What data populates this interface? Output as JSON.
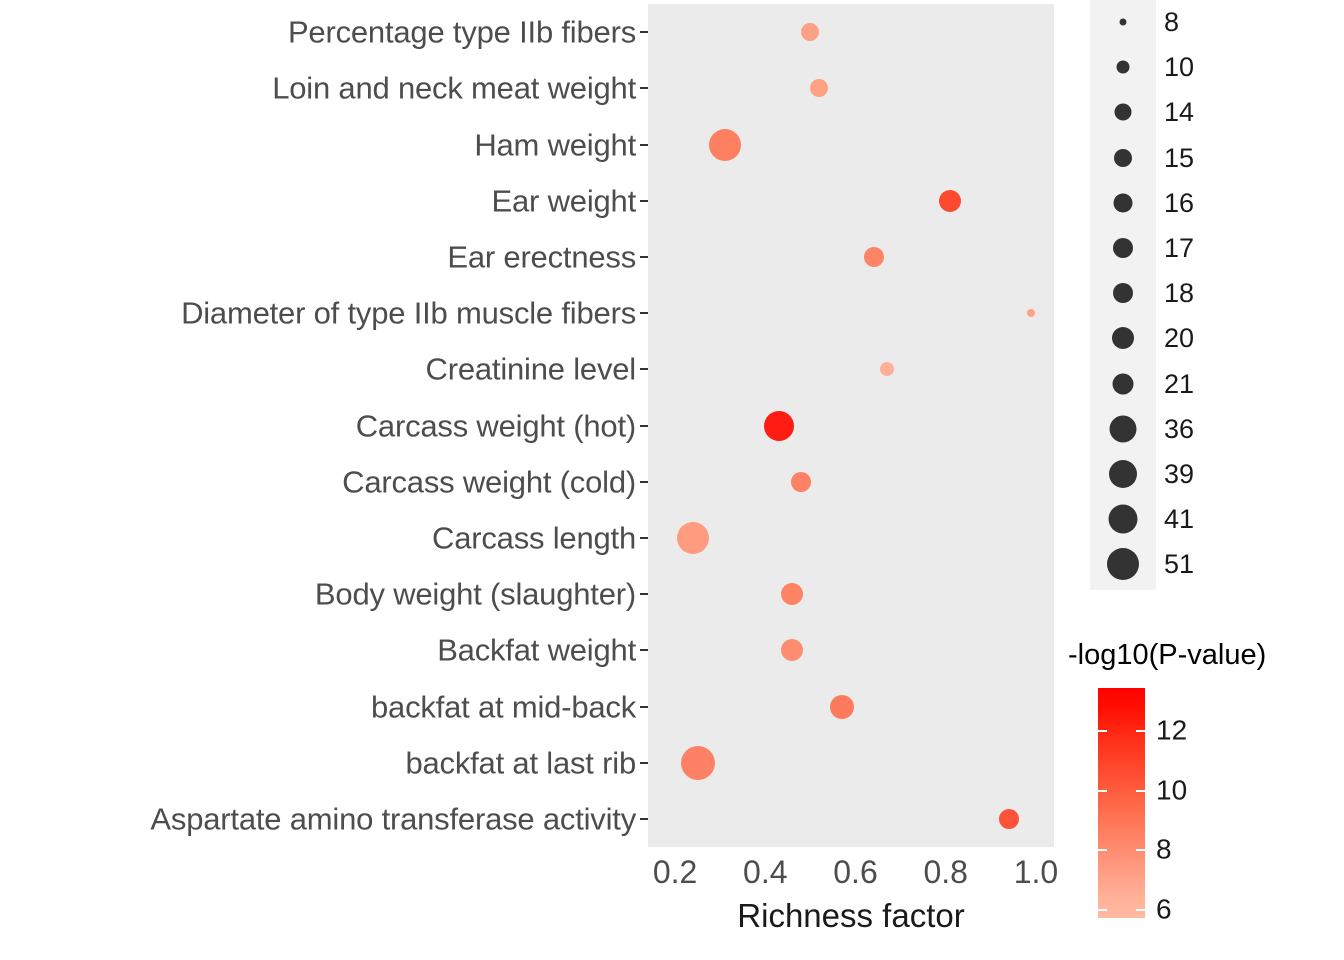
{
  "chart_data": {
    "type": "scatter",
    "title": "",
    "xlabel": "Richness factor",
    "ylabel": "",
    "xlim": [
      0.14,
      1.04
    ],
    "xticks": [
      "0.2",
      "0.4",
      "0.6",
      "0.8",
      "1.0"
    ],
    "xtick_values": [
      0.2,
      0.4,
      0.6,
      0.8,
      1.0
    ],
    "grid": false,
    "panel_background": "#ebebeb",
    "legend_position": "right",
    "categories": [
      "Percentage type IIb fibers",
      "Loin and neck meat weight",
      "Ham weight",
      "Ear weight",
      "Ear erectness",
      "Diameter of type IIb muscle fibers",
      "Creatinine level",
      "Carcass weight (hot)",
      "Carcass weight (cold)",
      "Carcass length",
      "Body weight (slaughter)",
      "Backfat weight",
      "backfat at mid-back",
      "backfat at last rib",
      "Aspartate amino transferase activity"
    ],
    "points": [
      {
        "label": "Percentage type IIb fibers",
        "x": 0.5,
        "count": 15,
        "neglog10p": 6.4,
        "color": "#ffa184",
        "radius": 9
      },
      {
        "label": "Loin and neck meat weight",
        "x": 0.52,
        "count": 15,
        "neglog10p": 6.6,
        "color": "#ffa183",
        "radius": 9
      },
      {
        "label": "Ham weight",
        "x": 0.31,
        "count": 39,
        "neglog10p": 8.2,
        "color": "#fd8061",
        "radius": 16
      },
      {
        "label": "Ear weight",
        "x": 0.81,
        "count": 20,
        "neglog10p": 11.3,
        "color": "#fc4a30",
        "radius": 11
      },
      {
        "label": "Ear erectness",
        "x": 0.64,
        "count": 18,
        "neglog10p": 8.4,
        "color": "#fd8467",
        "radius": 10
      },
      {
        "label": "Diameter of type IIb muscle fibers",
        "x": 0.99,
        "count": 8,
        "neglog10p": 6.9,
        "color": "#ffa184",
        "radius": 4
      },
      {
        "label": "Creatinine level",
        "x": 0.67,
        "count": 10,
        "neglog10p": 6.2,
        "color": "#ffb096",
        "radius": 7
      },
      {
        "label": "Carcass weight (hot)",
        "x": 0.43,
        "count": 36,
        "neglog10p": 13.2,
        "color": "#ff1c13",
        "radius": 15
      },
      {
        "label": "Carcass weight (cold)",
        "x": 0.48,
        "count": 17,
        "neglog10p": 8.3,
        "color": "#fd8265",
        "radius": 10
      },
      {
        "label": "Carcass length",
        "x": 0.24,
        "count": 41,
        "neglog10p": 6.7,
        "color": "#ff9c7f",
        "radius": 16
      },
      {
        "label": "Body weight (slaughter)",
        "x": 0.46,
        "count": 21,
        "neglog10p": 8.5,
        "color": "#fd8365",
        "radius": 11
      },
      {
        "label": "Backfat weight",
        "x": 0.46,
        "count": 21,
        "neglog10p": 7.9,
        "color": "#fe8c6e",
        "radius": 11
      },
      {
        "label": "backfat at mid-back",
        "x": 0.57,
        "count": 21,
        "neglog10p": 9.1,
        "color": "#fd7a5c",
        "radius": 12
      },
      {
        "label": "backfat at last rib",
        "x": 0.25,
        "count": 51,
        "neglog10p": 8.1,
        "color": "#fd8265",
        "radius": 17
      },
      {
        "label": "Aspartate amino transferase activity",
        "x": 0.94,
        "count": 16,
        "neglog10p": 10.5,
        "color": "#fd5338",
        "radius": 10
      }
    ],
    "size_legend": {
      "title": "",
      "values": [
        "8",
        "10",
        "14",
        "15",
        "16",
        "17",
        "18",
        "20",
        "21",
        "36",
        "39",
        "41",
        "51"
      ],
      "radii": [
        3.5,
        6.5,
        8.5,
        9,
        9.5,
        10,
        10,
        11,
        10.5,
        13.5,
        14,
        14.5,
        16
      ]
    },
    "color_legend": {
      "title": "-log10(P-value)",
      "ticks": [
        "12",
        "10",
        "8",
        "6"
      ],
      "tick_values": [
        12,
        10,
        8,
        6
      ],
      "low_color": "#ffbaa1",
      "high_color": "#ff0000",
      "range": [
        5.7,
        13.4
      ]
    }
  }
}
